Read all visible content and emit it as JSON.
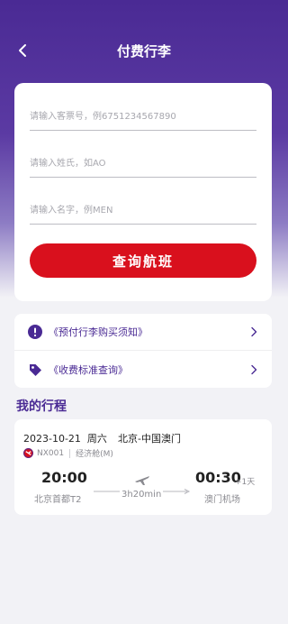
{
  "header": {
    "title": "付费行李",
    "back_icon": "chevron-left-icon"
  },
  "form": {
    "ticket_placeholder": "请输入客票号，例6751234567890",
    "surname_placeholder": "请输入姓氏，如AO",
    "given_name_placeholder": "请输入名字，例MEN",
    "query_label": "查询航班"
  },
  "links": [
    {
      "label": "《预付行李购买须知》",
      "icon": "info-icon"
    },
    {
      "label": "《收费标准查询》",
      "icon": "price-tag-icon"
    }
  ],
  "trips": {
    "section_title": "我的行程",
    "items": [
      {
        "date": "2023-10-21",
        "weekday": "周六",
        "date_line": "2023-10-21  周六",
        "route": "北京-中国澳门",
        "flight_no": "NX001",
        "cabin": "经济舱(M)",
        "dep_time": "20:00",
        "dep_airport": "北京首都T2",
        "arr_time": "00:30",
        "arr_day_offset": "+1天",
        "arr_airport": "澳门机场",
        "duration": "3h20min"
      }
    ]
  },
  "colors": {
    "brand_purple": "#4a2a94",
    "button_red": "#d9101d",
    "background": "#f2f2f6"
  }
}
